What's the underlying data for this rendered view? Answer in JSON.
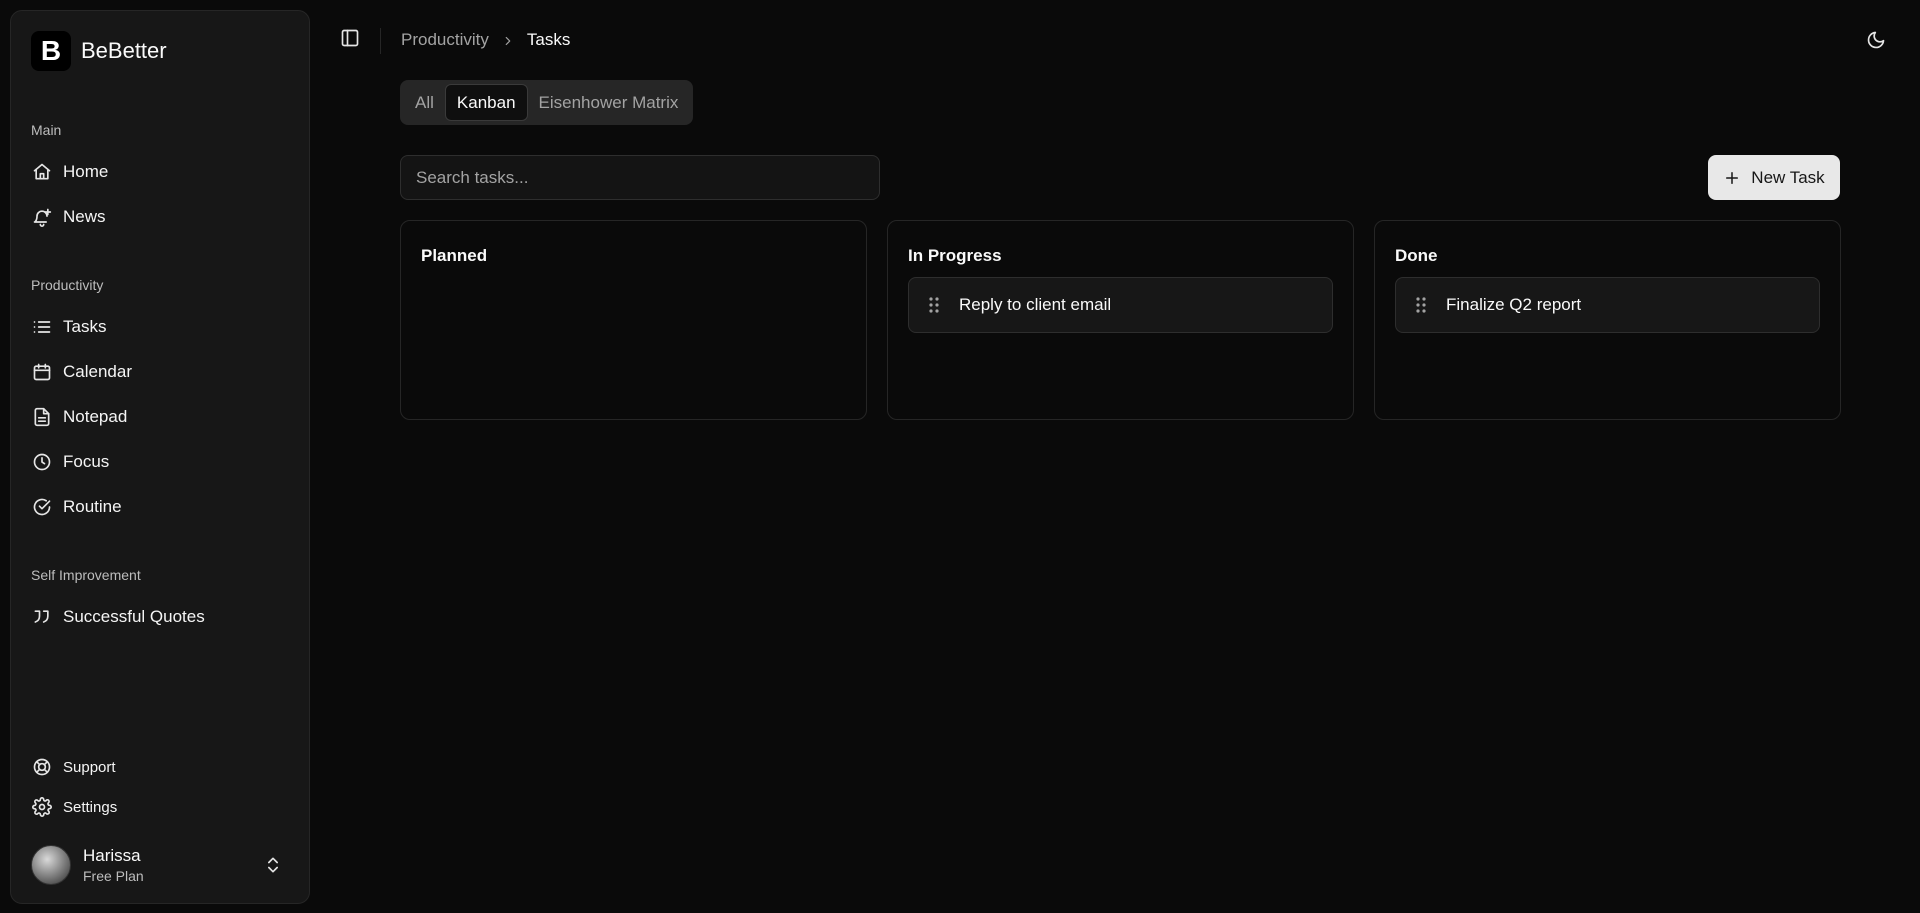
{
  "brand": {
    "logo_letter": "B",
    "name": "BeBetter"
  },
  "sidebar": {
    "groups": [
      {
        "label": "Main",
        "items": [
          {
            "label": "Home",
            "icon": "home-icon"
          },
          {
            "label": "News",
            "icon": "bell-plus-icon"
          }
        ]
      },
      {
        "label": "Productivity",
        "items": [
          {
            "label": "Tasks",
            "icon": "list-icon"
          },
          {
            "label": "Calendar",
            "icon": "calendar-icon"
          },
          {
            "label": "Notepad",
            "icon": "file-text-icon"
          },
          {
            "label": "Focus",
            "icon": "clock-icon"
          },
          {
            "label": "Routine",
            "icon": "check-circle-icon"
          }
        ]
      },
      {
        "label": "Self Improvement",
        "items": [
          {
            "label": "Successful Quotes",
            "icon": "quote-icon"
          }
        ]
      }
    ],
    "footer": [
      {
        "label": "Support",
        "icon": "life-buoy-icon"
      },
      {
        "label": "Settings",
        "icon": "gear-icon"
      }
    ],
    "user": {
      "name": "Harissa",
      "plan": "Free Plan"
    }
  },
  "header": {
    "breadcrumb": {
      "parent": "Productivity",
      "current": "Tasks"
    }
  },
  "tabs": [
    {
      "label": "All",
      "active": false
    },
    {
      "label": "Kanban",
      "active": true
    },
    {
      "label": "Eisenhower Matrix",
      "active": false
    }
  ],
  "search": {
    "placeholder": "Search tasks...",
    "value": ""
  },
  "new_task_label": "New Task",
  "columns": [
    {
      "title": "Planned",
      "cards": []
    },
    {
      "title": "In Progress",
      "cards": [
        {
          "title": "Reply to client email"
        }
      ]
    },
    {
      "title": "Done",
      "cards": [
        {
          "title": "Finalize Q2 report"
        }
      ]
    }
  ],
  "colors": {
    "background": "#0a0a0a",
    "sidebar": "#171717",
    "border": "#262626",
    "primary_button": "#e8e8e8"
  }
}
